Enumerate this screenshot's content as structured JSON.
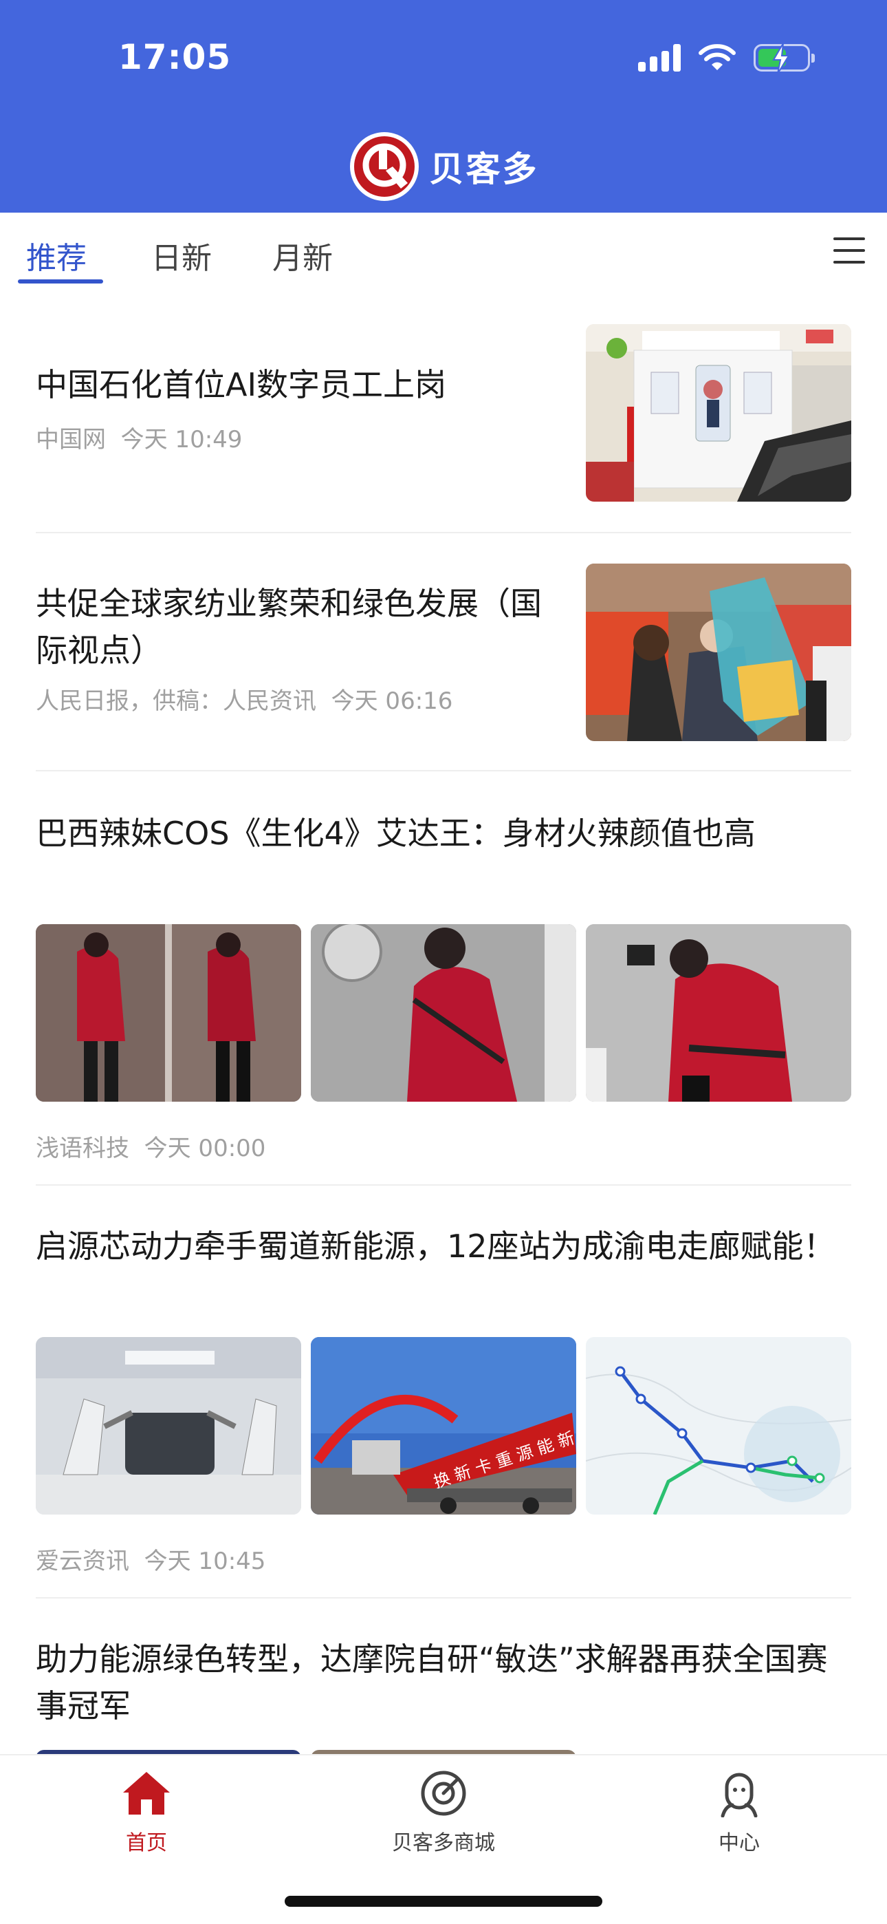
{
  "status_bar": {
    "time": "17:05",
    "icons": [
      "signal-icon",
      "wifi-icon",
      "battery-charging-icon"
    ]
  },
  "app": {
    "name": "贝客多",
    "brand_color": "#4466dd",
    "logo_color": "#c0191f"
  },
  "tabs": [
    {
      "label": "推荐",
      "active": true
    },
    {
      "label": "日新",
      "active": false
    },
    {
      "label": "月新",
      "active": false
    }
  ],
  "feed": [
    {
      "title": "中国石化首位AI数字员工上岗",
      "source": "中国网",
      "time": "今天 10:49",
      "layout": "single-image"
    },
    {
      "title": "共促全球家纺业繁荣和绿色发展（国际视点）",
      "source": "人民日报，供稿：人民资讯",
      "time": "今天 06:16",
      "layout": "single-image"
    },
    {
      "title": "巴西辣妹COS《生化4》艾达王：身材火辣颜值也高",
      "source": "浅语科技",
      "time": "今天 00:00",
      "layout": "three-images"
    },
    {
      "title": "启源芯动力牵手蜀道新能源，12座站为成渝电走廊赋能！",
      "source": "爱云资讯",
      "time": "今天 10:45",
      "layout": "three-images",
      "image_texts": {
        "banner": "换 新 卡 重 源 能 新"
      }
    },
    {
      "title": "助力能源绿色转型，达摩院自研“敏迭”求解器再获全国赛事冠军",
      "layout": "three-images"
    }
  ],
  "bottom_nav": [
    {
      "label": "首页",
      "icon": "home-icon",
      "active": true
    },
    {
      "label": "贝客多商城",
      "icon": "mall-icon",
      "active": false
    },
    {
      "label": "中心",
      "icon": "profile-icon",
      "active": false
    }
  ]
}
